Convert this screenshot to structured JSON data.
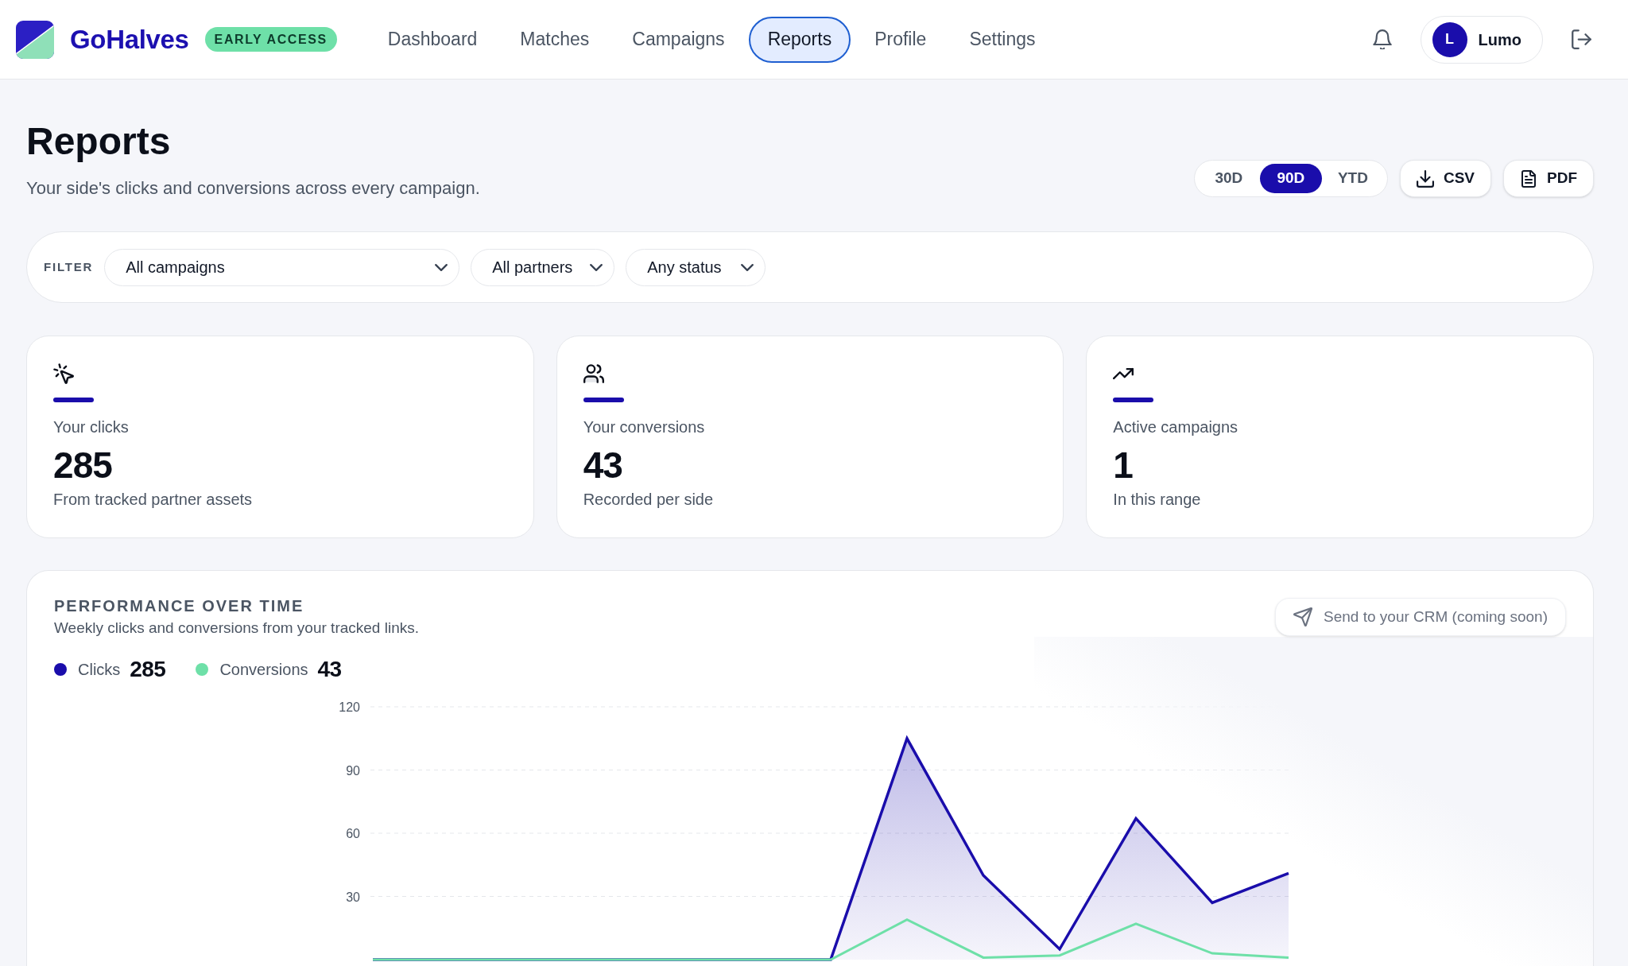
{
  "header": {
    "brand": "GoHalves",
    "badge": "EARLY ACCESS",
    "nav": [
      {
        "label": "Dashboard",
        "selected": false
      },
      {
        "label": "Matches",
        "selected": false
      },
      {
        "label": "Campaigns",
        "selected": false
      },
      {
        "label": "Reports",
        "selected": true
      },
      {
        "label": "Profile",
        "selected": false
      },
      {
        "label": "Settings",
        "selected": false
      }
    ],
    "user": {
      "initial": "L",
      "name": "Lumo"
    }
  },
  "page": {
    "title": "Reports",
    "subtitle": "Your side's clicks and conversions across every campaign."
  },
  "range_tabs": [
    {
      "label": "30D",
      "selected": false
    },
    {
      "label": "90D",
      "selected": true
    },
    {
      "label": "YTD",
      "selected": false
    }
  ],
  "exports": [
    {
      "kind": "download",
      "label": "CSV"
    },
    {
      "kind": "document",
      "label": "PDF"
    }
  ],
  "filter": {
    "label": "FILTER",
    "dropdowns": [
      {
        "value": "All campaigns"
      },
      {
        "value": "All partners"
      },
      {
        "value": "Any status"
      }
    ]
  },
  "stats": [
    {
      "kind": "clicks",
      "label": "Your clicks",
      "value": "285",
      "note": "From tracked partner assets"
    },
    {
      "kind": "users",
      "label": "Your conversions",
      "value": "43",
      "note": "Recorded per side"
    },
    {
      "kind": "trend",
      "label": "Active campaigns",
      "value": "1",
      "note": "In this range"
    }
  ],
  "performance": {
    "title": "PERFORMANCE OVER TIME",
    "subtitle": "Weekly clicks and conversions from your tracked links.",
    "crm_button": {
      "label": "Send to your CRM (coming soon)",
      "disabled": true
    },
    "totals": [
      "285",
      "43"
    ],
    "chart_data": {
      "type": "area",
      "series": [
        {
          "name": "Clicks",
          "color": "#1a0dab",
          "values": [
            0,
            0,
            0,
            0,
            0,
            0,
            0,
            105,
            40,
            5,
            67,
            27,
            41
          ]
        },
        {
          "name": "Conversions",
          "color": "#6ee0a8",
          "type": "line",
          "values": [
            0,
            0,
            0,
            0,
            0,
            0,
            0,
            19,
            1,
            2,
            17,
            3,
            1
          ]
        }
      ],
      "ylim": [
        0,
        120
      ],
      "yticks": [
        30,
        60,
        90,
        120
      ],
      "grid": true
    }
  }
}
